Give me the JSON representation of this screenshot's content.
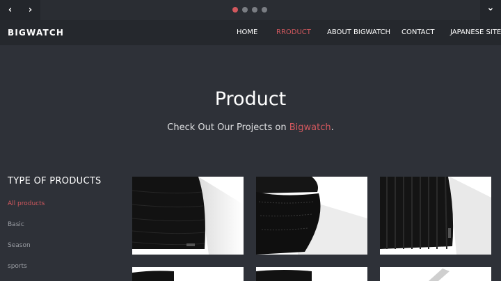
{
  "slider": {
    "prev_icon": "chevron-left-icon",
    "next_icon": "chevron-right-icon",
    "expand_icon": "chevron-down-icon",
    "prev_glyph": "‹",
    "next_glyph": "›",
    "expand_glyph": "⌄",
    "dot_count": 4,
    "active_dot": 1
  },
  "nav": {
    "logo": "BIGWATCH",
    "items": [
      "HOME",
      "RRODUCT",
      "ABOUT BIGWATCH",
      "CONTACT",
      "JAPANESE SITE"
    ],
    "active_index": 1
  },
  "hero": {
    "title": "Product",
    "subtitle_before": "Check Out Our Projects on ",
    "subtitle_accent": "Bigwatch",
    "subtitle_after": "."
  },
  "sidebar": {
    "heading": "TYPE OF PRODUCTS",
    "items": [
      "All products",
      "Basic",
      "Season",
      "sports"
    ],
    "active_index": 0
  },
  "colors": {
    "accent": "#d2585e",
    "background": "#2e3138",
    "nav_background": "#25282d"
  }
}
